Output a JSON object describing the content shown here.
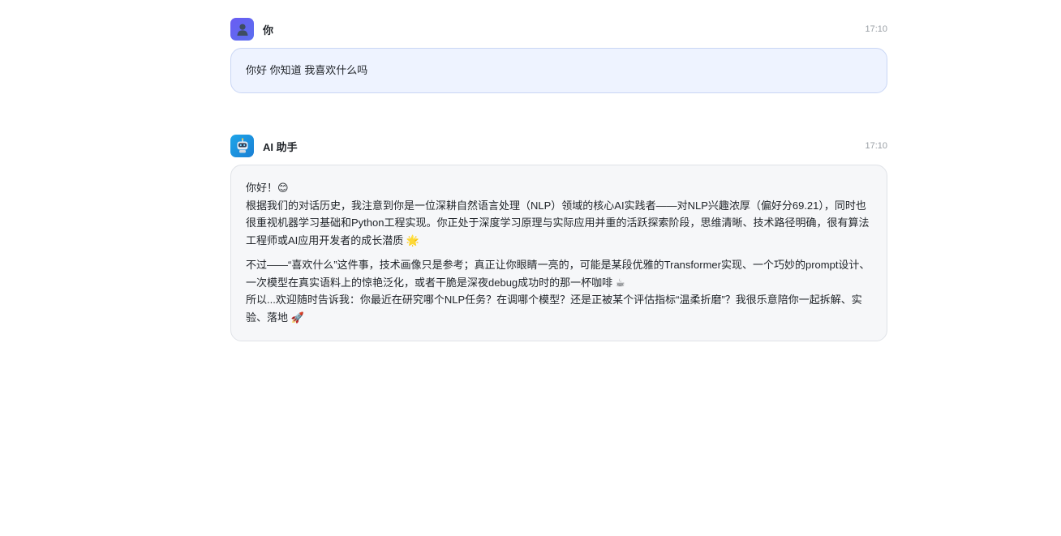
{
  "messages": [
    {
      "sender": "你",
      "time": "17:10",
      "avatar_icon": "user-silhouette-icon",
      "text": "你好 你知道 我喜欢什么吗"
    },
    {
      "sender": "AI 助手",
      "time": "17:10",
      "avatar_icon": "robot-icon",
      "paragraphs": [
        "你好！😊",
        "根据我们的对话历史，我注意到你是一位深耕自然语言处理（NLP）领域的核心AI实践者——对NLP兴趣浓厚（偏好分69.21），同时也很重视机器学习基础和Python工程实现。你正处于深度学习原理与实际应用并重的活跃探索阶段，思维清晰、技术路径明确，很有算法工程师或AI应用开发者的成长潜质 🌟",
        "不过——“喜欢什么”这件事，技术画像只是参考；真正让你眼睛一亮的，可能是某段优雅的Transformer实现、一个巧妙的prompt设计、一次模型在真实语料上的惊艳泛化，或者干脆是深夜debug成功时的那一杯咖啡 ☕",
        "所以...欢迎随时告诉我：你最近在研究哪个NLP任务？在调哪个模型？还是正被某个评估指标“温柔折磨”？我很乐意陪你一起拆解、实验、落地 🚀"
      ]
    }
  ]
}
